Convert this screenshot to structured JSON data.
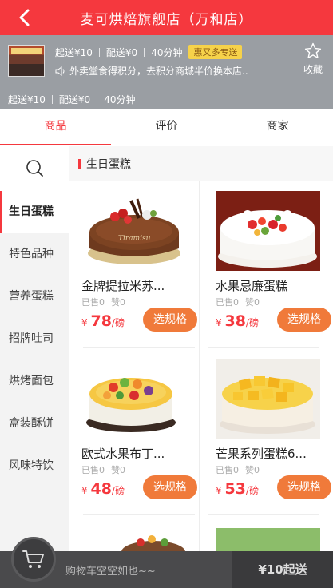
{
  "header": {
    "title": "麦可烘焙旗舰店（万和店）"
  },
  "store": {
    "row1": {
      "min_order": "起送¥10",
      "delivery": "配送¥0",
      "time": "40分钟",
      "promo_badge": "惠又多专送"
    },
    "notice": "外卖堂食得积分，去积分商城半价换本店..",
    "favorite_label": "收藏",
    "row3": {
      "min_order": "起送¥10",
      "delivery": "配送¥0",
      "time": "40分钟"
    }
  },
  "tabs": [
    {
      "label": "商品",
      "active": true
    },
    {
      "label": "评价",
      "active": false
    },
    {
      "label": "商家",
      "active": false
    }
  ],
  "sidebar": {
    "categories": [
      "生日蛋糕",
      "特色品种",
      "营养蛋糕",
      "招牌吐司",
      "烘烤面包",
      "盒装酥饼",
      "风味特饮"
    ],
    "active_index": 0
  },
  "section": {
    "title": "生日蛋糕"
  },
  "products": [
    {
      "name": "金牌提拉米苏...",
      "sold": "已售0",
      "likes": "赞0",
      "currency": "¥",
      "price": "78",
      "unit": "/磅",
      "button": "选规格"
    },
    {
      "name": "水果忌廉蛋糕",
      "sold": "已售0",
      "likes": "赞0",
      "currency": "¥",
      "price": "38",
      "unit": "/磅",
      "button": "选规格"
    },
    {
      "name": "欧式水果布丁...",
      "sold": "已售0",
      "likes": "赞0",
      "currency": "¥",
      "price": "48",
      "unit": "/磅",
      "button": "选规格"
    },
    {
      "name": "芒果系列蛋糕6...",
      "sold": "已售0",
      "likes": "赞0",
      "currency": "¥",
      "price": "53",
      "unit": "/磅",
      "button": "选规格"
    }
  ],
  "cart": {
    "empty_text": "购物车空空如也~~",
    "min_order_button": "¥10起送"
  },
  "colors": {
    "accent": "#f5383e",
    "button": "#f07a3a",
    "store_bg": "#9a9ea3",
    "cart_bg": "#4a4a4c"
  }
}
